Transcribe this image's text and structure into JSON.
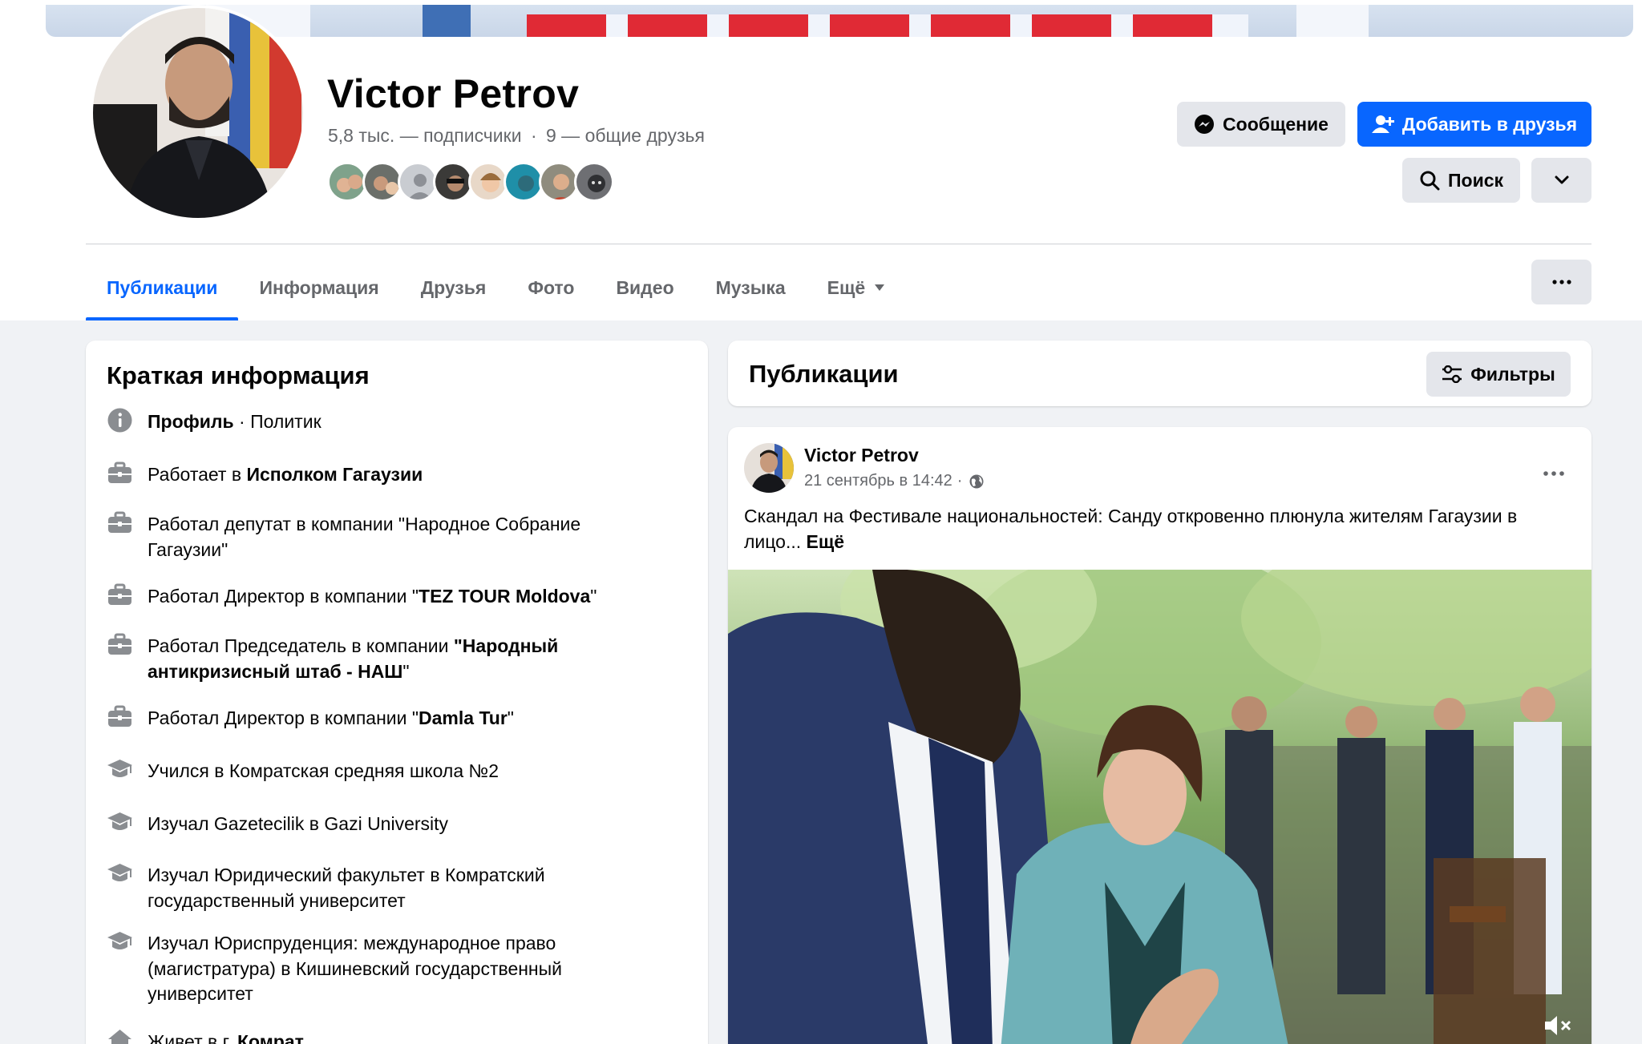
{
  "profile": {
    "name": "Victor Petrov",
    "followers": "5,8 тыс. — подписчики",
    "mutual": "9 — общие друзья",
    "separator": "·"
  },
  "actions": {
    "message_label": "Сообщение",
    "add_friend_label": "Добавить в друзья",
    "search_label": "Поиск"
  },
  "tabs": [
    {
      "label": "Публикации",
      "active": true
    },
    {
      "label": "Информация"
    },
    {
      "label": "Друзья"
    },
    {
      "label": "Фото"
    },
    {
      "label": "Видео"
    },
    {
      "label": "Музыка"
    },
    {
      "label": "Ещё"
    }
  ],
  "intro": {
    "title": "Краткая информация",
    "items": [
      {
        "icon": "info-icon",
        "pre": "",
        "bold": "Профиль",
        "post": " · Политик"
      },
      {
        "icon": "briefcase-icon",
        "pre": "Работает в ",
        "bold": "Исполком Гагаузии",
        "post": ""
      },
      {
        "icon": "briefcase-icon",
        "pre": "Работал депутат в компании \"Народное Собрание Гагаузии\"",
        "bold": "",
        "post": ""
      },
      {
        "icon": "briefcase-icon",
        "pre": "Работал Директор в компании \"",
        "bold": "TEZ TOUR Moldova",
        "post": "\""
      },
      {
        "icon": "briefcase-icon",
        "pre": "Работал Председатель в компании ",
        "bold": "\"Народный антикризисный штаб - НАШ",
        "post": "\""
      },
      {
        "icon": "briefcase-icon",
        "pre": "Работал Директор в компании \"",
        "bold": "Damla Tur",
        "post": "\""
      },
      {
        "icon": "graduation-cap-icon",
        "pre": "Учился в Комратская средняя школа №2",
        "bold": "",
        "post": ""
      },
      {
        "icon": "graduation-cap-icon",
        "pre": "Изучал Gazetecilik в Gazi University",
        "bold": "",
        "post": ""
      },
      {
        "icon": "graduation-cap-icon",
        "pre": "Изучал Юридический факультет в Комратский государственный университет",
        "bold": "",
        "post": ""
      },
      {
        "icon": "graduation-cap-icon",
        "pre": "Изучал Юриспруденция: международное право (магистратура) в Кишиневский государственный университет",
        "bold": "",
        "post": ""
      },
      {
        "icon": "home-icon",
        "pre": "Живет в г. ",
        "bold": "Комрат",
        "post": ""
      }
    ]
  },
  "posts": {
    "title": "Публикации",
    "filters_label": "Фильтры",
    "post": {
      "author": "Victor Petrov",
      "date": "21 сентябрь в 14:42",
      "meta_sep": "·",
      "text": "Скандал на Фестивале национальностей: Санду откровенно плюнула жителям Гагаузии в лицо...",
      "more": "Ещё"
    }
  },
  "colors": {
    "accent": "#0866ff",
    "secondary_text": "#65676b",
    "button_grey": "#e4e6eb",
    "page_bg": "#f0f2f5"
  }
}
